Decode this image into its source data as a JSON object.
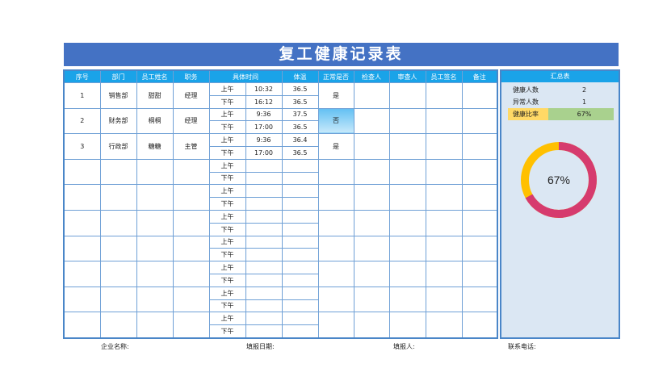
{
  "title": "复工健康记录表",
  "headers": [
    "序号",
    "部门",
    "员工姓名",
    "职务",
    "具体时间",
    "体温",
    "正常是否",
    "检查人",
    "审查人",
    "员工签名",
    "备注"
  ],
  "employees": [
    {
      "no": "1",
      "dept": "销售部",
      "name": "甜甜",
      "role": "经理",
      "normal": "是",
      "am": {
        "label": "上午",
        "time": "10:32",
        "temp": "36.5"
      },
      "pm": {
        "label": "下午",
        "time": "16:12",
        "temp": "36.5"
      }
    },
    {
      "no": "2",
      "dept": "财务部",
      "name": "桐桐",
      "role": "经理",
      "normal": "否",
      "am": {
        "label": "上午",
        "time": "9:36",
        "temp": "37.5"
      },
      "pm": {
        "label": "下午",
        "time": "17:00",
        "temp": "36.5"
      }
    },
    {
      "no": "3",
      "dept": "行政部",
      "name": "糖糖",
      "role": "主管",
      "normal": "是",
      "am": {
        "label": "上午",
        "time": "9:36",
        "temp": "36.4"
      },
      "pm": {
        "label": "下午",
        "time": "17:00",
        "temp": "36.5"
      }
    }
  ],
  "empty_rows": {
    "am": "上午",
    "pm": "下午",
    "count": 7
  },
  "summary": {
    "title": "汇总表",
    "healthy_label": "健康人数",
    "healthy_value": "2",
    "abnormal_label": "异常人数",
    "abnormal_value": "1",
    "ratio_label": "健康比率",
    "ratio_value": "67%",
    "ratio_fraction": 0.67,
    "chart_center": "67%",
    "colors": {
      "healthy": "#d63b6e",
      "other": "#ffc000"
    }
  },
  "footer": {
    "company": "企业名称:",
    "date": "填报日期:",
    "filler": "填报人:",
    "phone": "联系电话:"
  }
}
